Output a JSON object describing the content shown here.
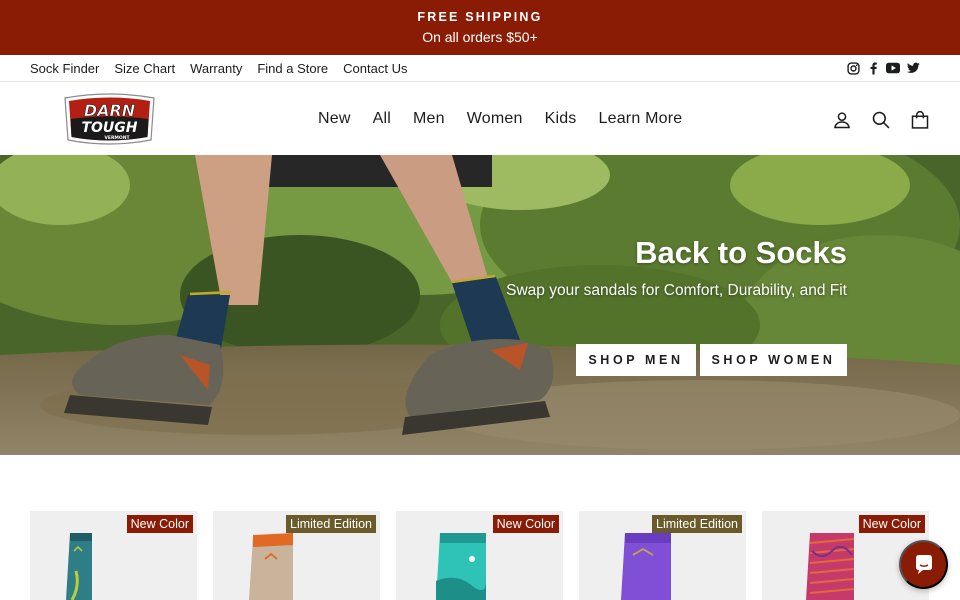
{
  "announcement": {
    "title": "FREE SHIPPING",
    "subtitle": "On all orders $50+"
  },
  "utility_links": [
    "Sock Finder",
    "Size Chart",
    "Warranty",
    "Find a Store",
    "Contact Us"
  ],
  "social_icons": [
    "instagram-icon",
    "facebook-icon",
    "youtube-icon",
    "twitter-icon"
  ],
  "logo": {
    "line1": "DARN",
    "line2": "TOUGH",
    "line3": "VERMONT"
  },
  "nav": [
    "New",
    "All",
    "Men",
    "Women",
    "Kids",
    "Learn More"
  ],
  "header_icons": [
    "account-icon",
    "search-icon",
    "cart-icon"
  ],
  "hero": {
    "title": "Back to Socks",
    "subtitle": "Swap your sandals for Comfort, Durability, and Fit",
    "buttons": [
      "SHOP MEN",
      "SHOP WOMEN"
    ]
  },
  "products": [
    {
      "badge": "New Color",
      "badge_type": "new",
      "color": "#2f7d86"
    },
    {
      "badge": "Limited Edition",
      "badge_type": "ltd",
      "color": "#c9b39a"
    },
    {
      "badge": "New Color",
      "badge_type": "new",
      "color": "#2fc3b8"
    },
    {
      "badge": "Limited Edition",
      "badge_type": "ltd",
      "color": "#7f4fd6"
    },
    {
      "badge": "New Color",
      "badge_type": "new",
      "color": "#c53a6a"
    }
  ],
  "colors": {
    "brand_red": "#8a1c05",
    "badge_olive": "#6b5a2a"
  }
}
